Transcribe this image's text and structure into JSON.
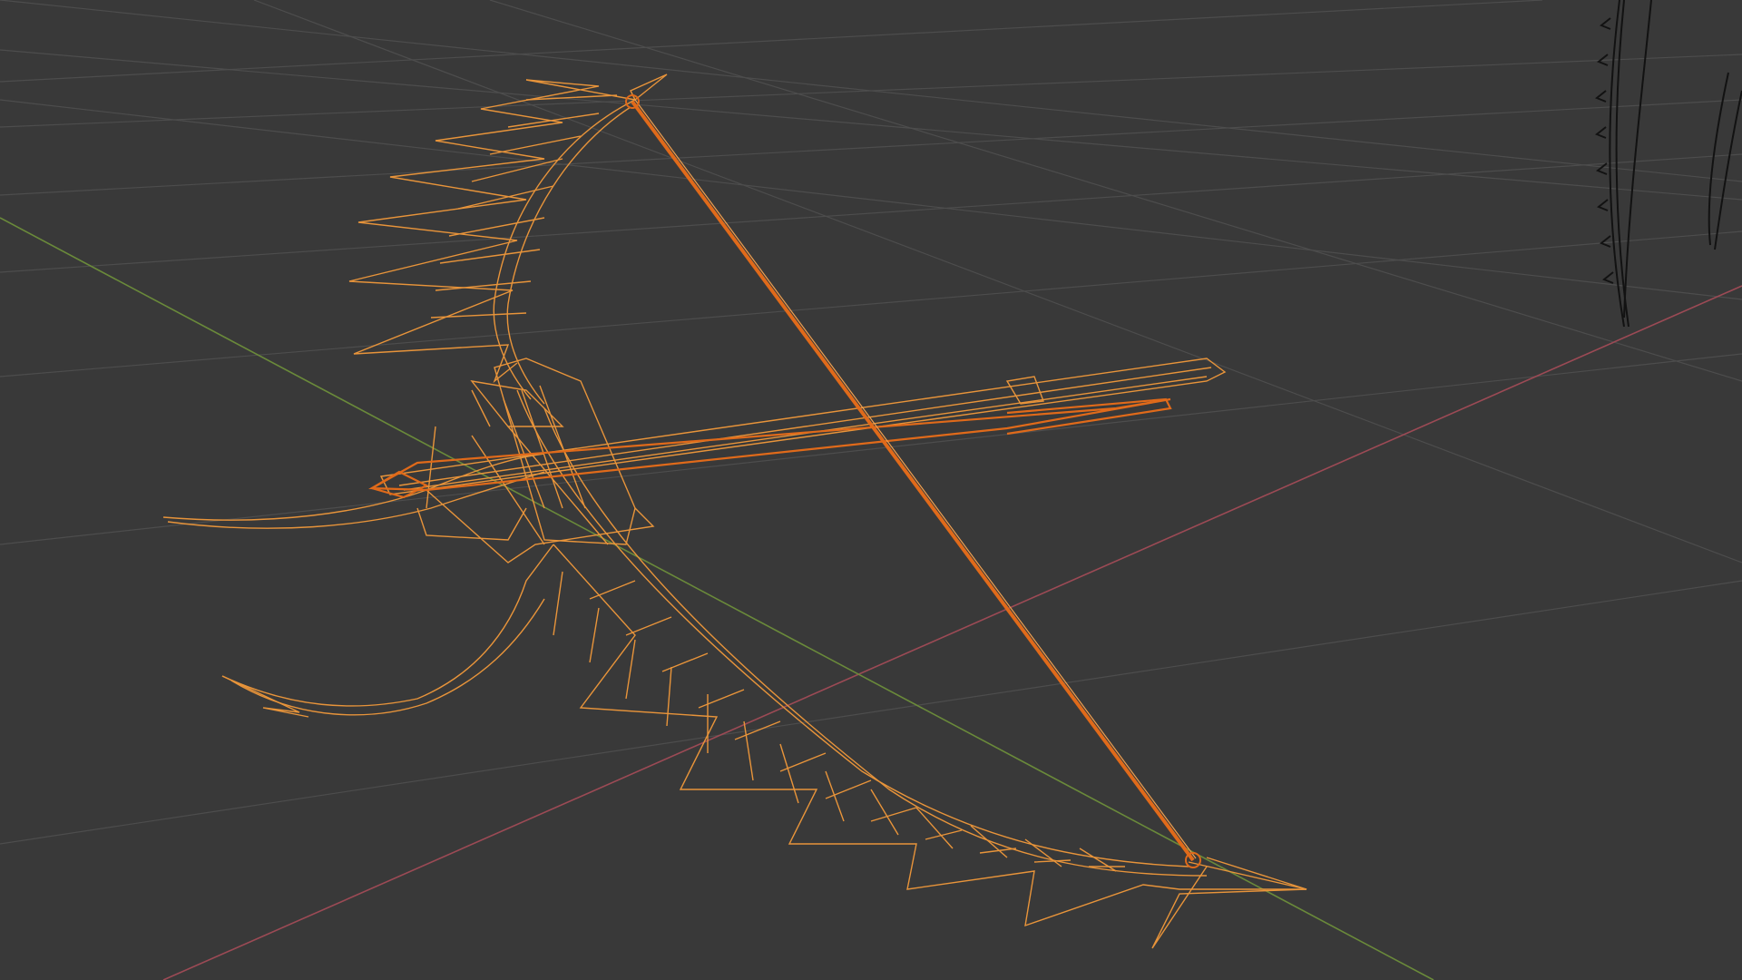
{
  "viewport": {
    "mode": "wireframe",
    "background_color": "#393939",
    "grid_color": "#535353",
    "x_axis_color": "#9c4a55",
    "y_axis_color": "#6a8a3a",
    "selected_object_color": "#e8943a",
    "active_edge_color": "#e06a1a",
    "unselected_object_color": "#111111"
  },
  "objects": [
    {
      "name": "bow-mesh",
      "selected": true
    },
    {
      "name": "arrow-mesh",
      "selected": true
    },
    {
      "name": "bowstring-mesh",
      "selected": true
    },
    {
      "name": "background-bow-mesh",
      "selected": false
    }
  ]
}
